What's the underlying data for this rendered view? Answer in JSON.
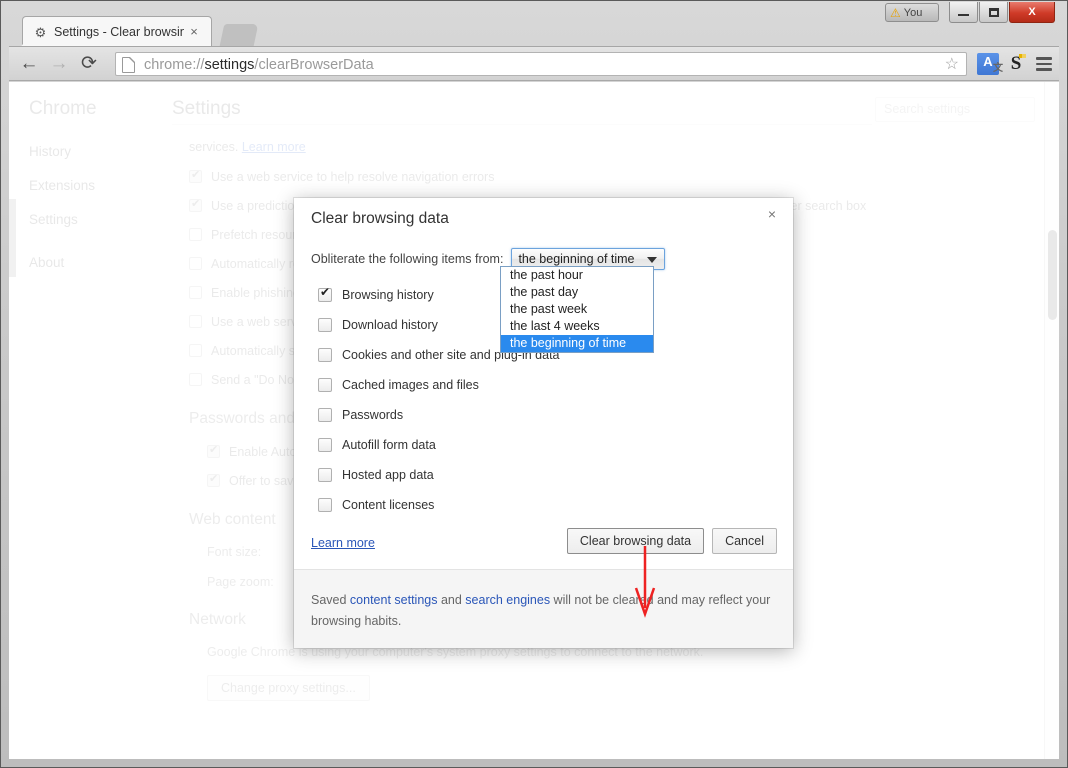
{
  "window": {
    "you_button_label": "You",
    "you_warning_icon": "warning-triangle-icon",
    "minimize_label": "Minimize",
    "maximize_label": "Maximize",
    "close_label": "X"
  },
  "tab": {
    "favicon": "gear-icon",
    "title": "Settings - Clear browsing",
    "close_label": "×"
  },
  "toolbar": {
    "back_glyph": "←",
    "forward_glyph": "→",
    "reload_glyph": "⟳",
    "url_prefix": "chrome://",
    "url_bold": "settings",
    "url_suffix": "/clearBrowserData",
    "star_glyph": "☆",
    "translate_letter": "A",
    "s_letter": "S"
  },
  "settings": {
    "brand": "Chrome",
    "nav_items": [
      "History",
      "Extensions",
      "Settings",
      "About"
    ],
    "title": "Settings",
    "search_placeholder": "Search settings",
    "privacy_intro_text": "services.",
    "privacy_intro_link": "Learn more",
    "privacy_checkboxes": [
      {
        "label": "Use a web service to help resolve navigation errors",
        "checked": true
      },
      {
        "label": "Use a prediction service to help complete searches and URLs typed in the address bar or the app launcher search box",
        "checked": true
      },
      {
        "label": "Prefetch resources to load pages more quickly",
        "checked": false
      },
      {
        "label": "Automatically report details of possible security incidents to Google",
        "checked": false
      },
      {
        "label": "Enable phishing and malware protection",
        "checked": false
      },
      {
        "label": "Use a web service to help resolve spelling errors",
        "checked": false
      },
      {
        "label": "Automatically send usage statistics and crash reports to Google",
        "checked": false
      },
      {
        "label": "Send a \"Do Not Track\" request with your browsing traffic",
        "checked": false
      }
    ],
    "passwords_heading": "Passwords and forms",
    "passwords_checkboxes": [
      {
        "label": "Enable Autofill to fill out web forms in a single click.",
        "checked": true
      },
      {
        "label": "Offer to save your web passwords.",
        "checked": true
      }
    ],
    "webcontent_heading": "Web content",
    "font_size_label": "Font size:",
    "page_zoom_label": "Page zoom:",
    "network_heading": "Network",
    "network_text": "Google Chrome is using your computer's system proxy settings to connect to the network.",
    "proxy_button": "Change proxy settings..."
  },
  "dialog": {
    "title": "Clear browsing data",
    "close_glyph": "×",
    "time_range_label": "Obliterate the following items from:",
    "time_range_value": "the beginning of time",
    "time_range_options": [
      "the past hour",
      "the past day",
      "the past week",
      "the last 4 weeks",
      "the beginning of time"
    ],
    "time_range_selected_index": 4,
    "items": [
      {
        "label": "Browsing history",
        "checked": true
      },
      {
        "label": "Download history",
        "checked": false
      },
      {
        "label": "Cookies and other site and plug-in data",
        "checked": false
      },
      {
        "label": "Cached images and files",
        "checked": false
      },
      {
        "label": "Passwords",
        "checked": false
      },
      {
        "label": "Autofill form data",
        "checked": false
      },
      {
        "label": "Hosted app data",
        "checked": false
      },
      {
        "label": "Content licenses",
        "checked": false
      }
    ],
    "learn_more": "Learn more",
    "confirm_button": "Clear browsing data",
    "cancel_button": "Cancel",
    "footer": {
      "part1": "Saved ",
      "link1": "content settings",
      "part2": " and ",
      "link2": "search engines",
      "part3": " will not be cleared and may reflect your browsing habits."
    }
  },
  "annotation": {
    "arrow_color": "#ee2222",
    "points_to": "Clear browsing data"
  }
}
